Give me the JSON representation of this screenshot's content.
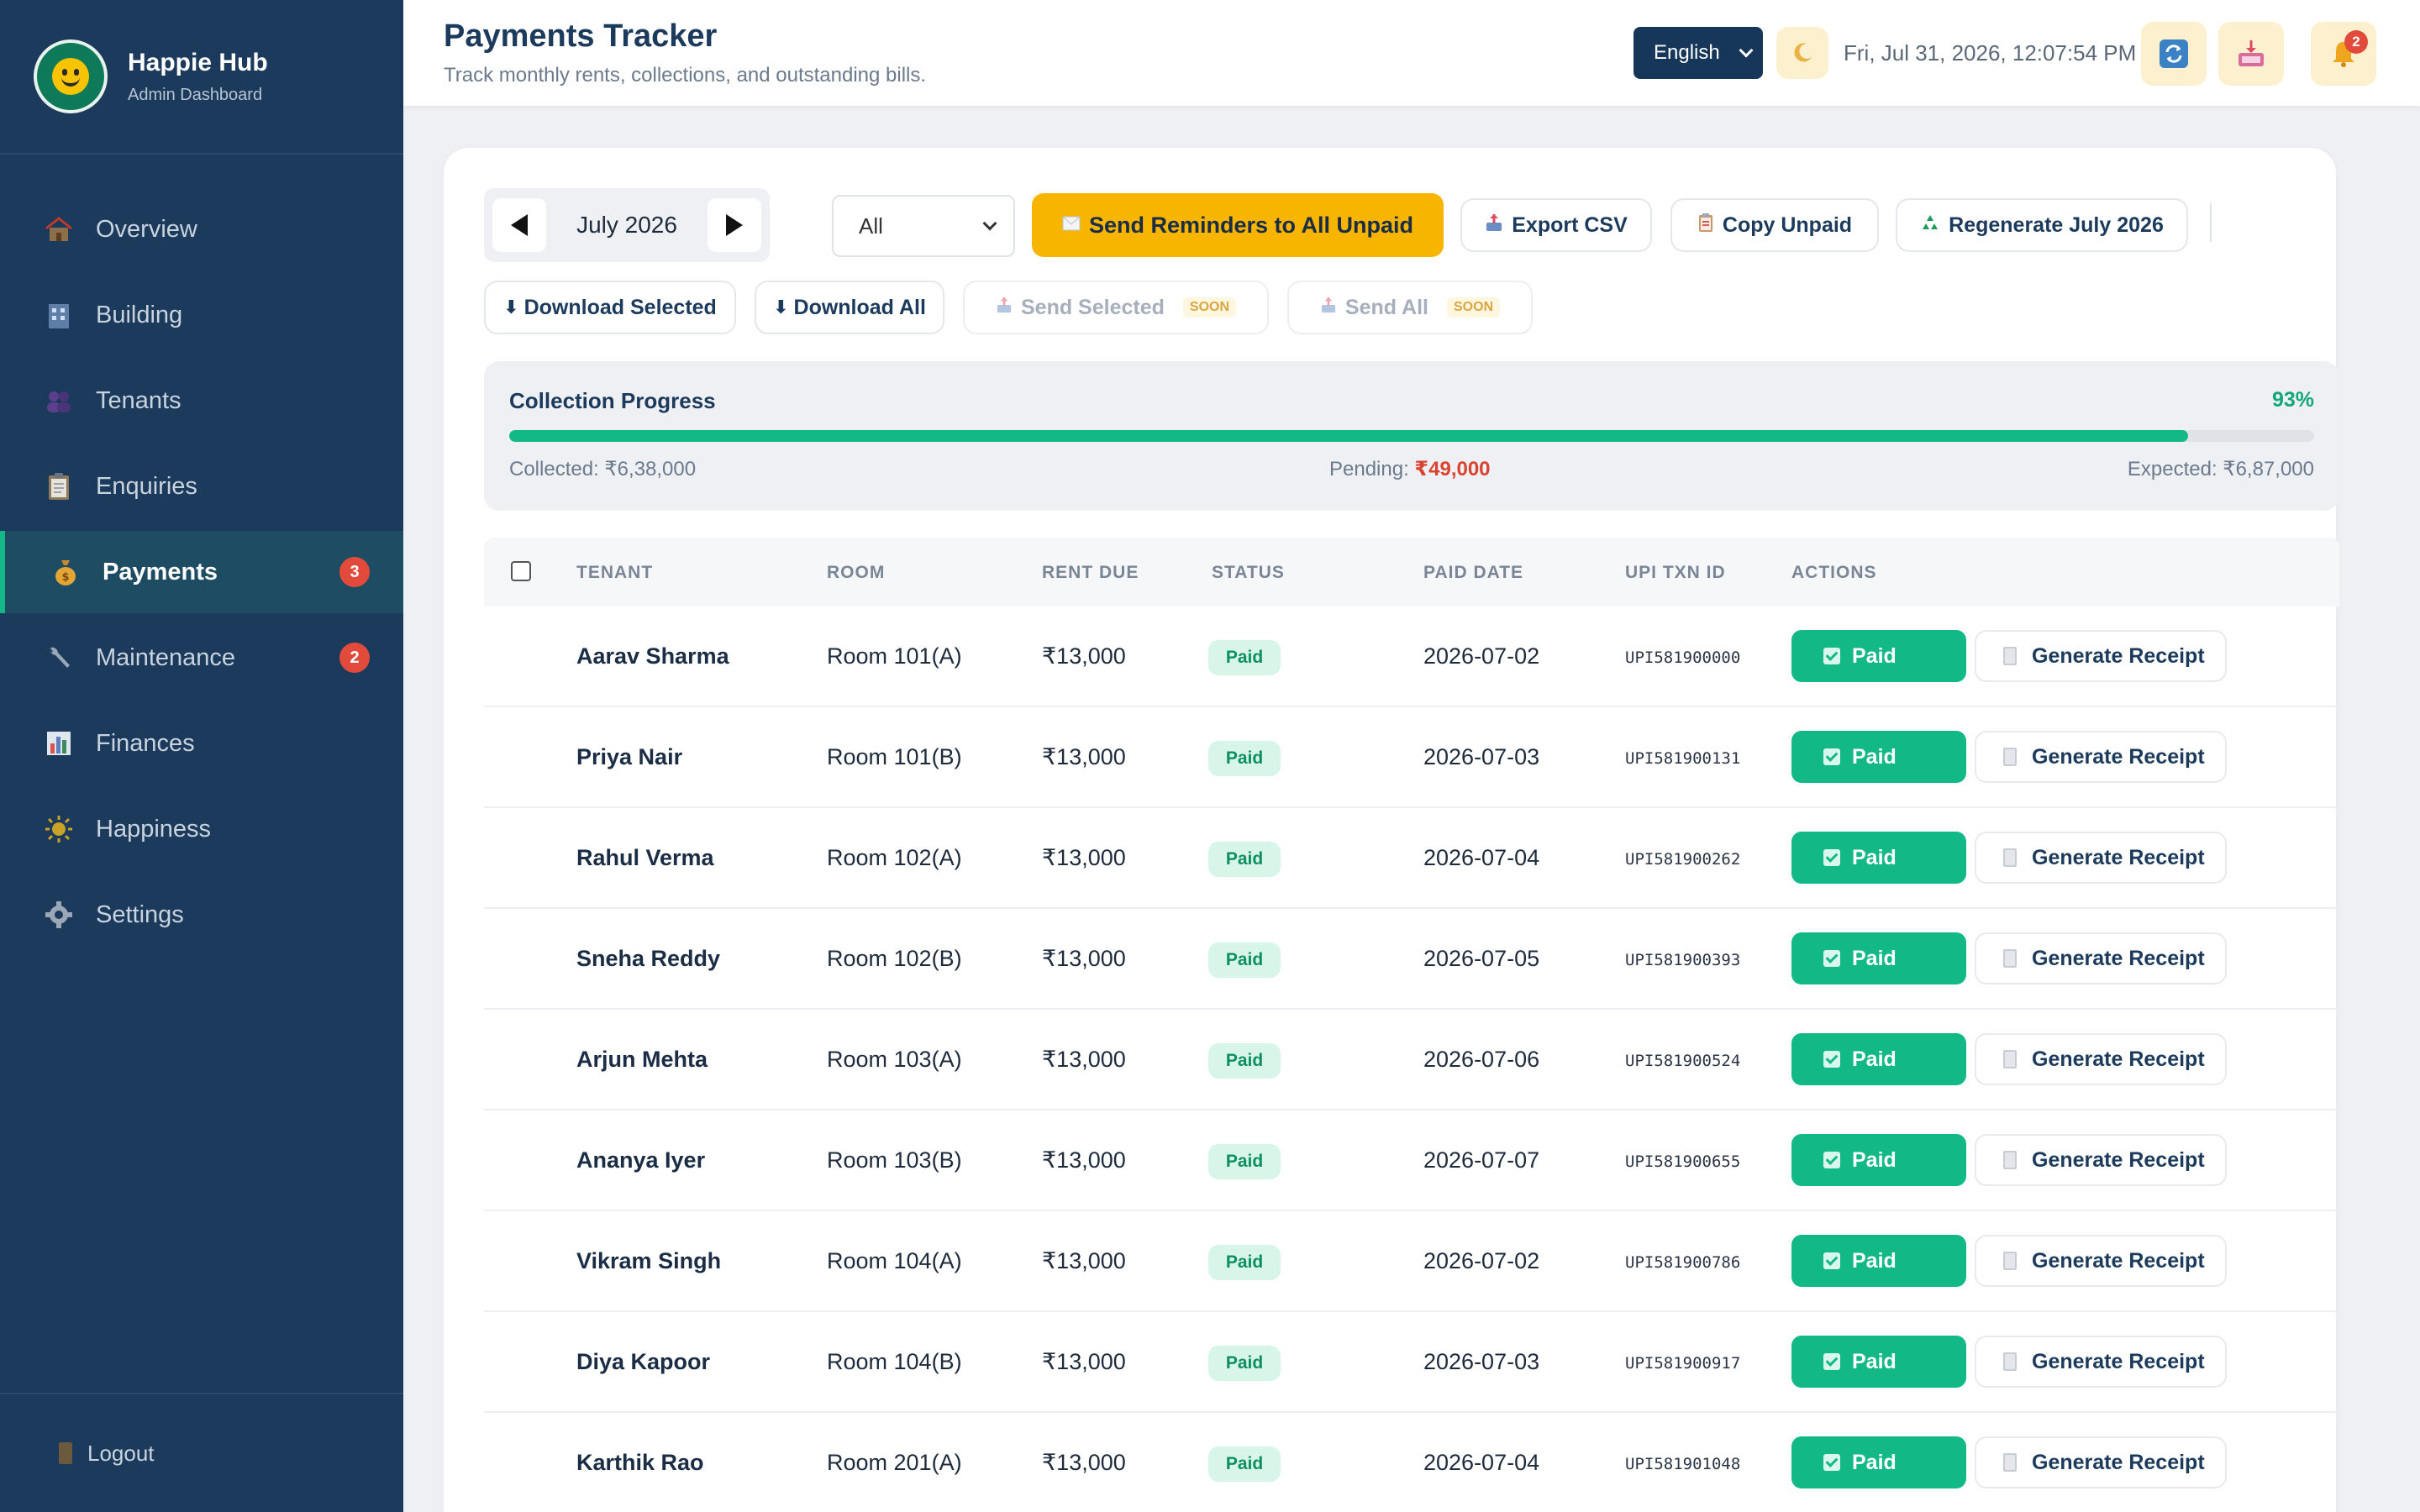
{
  "brand": {
    "title": "Happie Hub",
    "subtitle": "Admin Dashboard"
  },
  "sidebar": {
    "items": [
      {
        "label": "Overview",
        "icon": "house-icon"
      },
      {
        "label": "Building",
        "icon": "building-icon"
      },
      {
        "label": "Tenants",
        "icon": "people-icon"
      },
      {
        "label": "Enquiries",
        "icon": "clipboard-icon"
      },
      {
        "label": "Payments",
        "icon": "money-bag-icon",
        "active": true,
        "badge": "3"
      },
      {
        "label": "Maintenance",
        "icon": "wrench-icon",
        "badge": "2"
      },
      {
        "label": "Finances",
        "icon": "bar-chart-icon"
      },
      {
        "label": "Happiness",
        "icon": "sun-icon"
      },
      {
        "label": "Settings",
        "icon": "gear-icon"
      }
    ],
    "logout_label": "Logout"
  },
  "header": {
    "title": "Payments Tracker",
    "subtitle": "Track monthly rents, collections, and outstanding bills.",
    "language": "English",
    "datetime": "Fri, Jul 31, 2026, 12:07:54 PM",
    "notification_count": "2"
  },
  "toolbar": {
    "month": "July 2026",
    "filter_value": "All",
    "send_reminders": "Send Reminders to All Unpaid",
    "export_csv": "Export CSV",
    "copy_unpaid": "Copy Unpaid",
    "regenerate": "Regenerate July 2026",
    "download_selected": "Download Selected",
    "download_all": "Download All",
    "send_selected": "Send Selected",
    "send_all": "Send All",
    "soon": "SOON"
  },
  "progress": {
    "title": "Collection Progress",
    "percent": "93%",
    "fraction": 0.93,
    "collected_label": "Collected:",
    "collected": "₹6,38,000",
    "pending_label": "Pending:",
    "pending": "₹49,000",
    "expected_label": "Expected:",
    "expected": "₹6,87,000"
  },
  "table": {
    "columns": [
      "TENANT",
      "ROOM",
      "RENT DUE",
      "STATUS",
      "PAID DATE",
      "UPI TXN ID",
      "ACTIONS"
    ],
    "paid_button": "Paid",
    "receipt_button": "Generate Receipt",
    "rows": [
      {
        "tenant": "Aarav Sharma",
        "room": "Room 101(A)",
        "rent": "₹13,000",
        "status": "Paid",
        "date": "2026-07-02",
        "upi": "UPI581900000"
      },
      {
        "tenant": "Priya Nair",
        "room": "Room 101(B)",
        "rent": "₹13,000",
        "status": "Paid",
        "date": "2026-07-03",
        "upi": "UPI581900131"
      },
      {
        "tenant": "Rahul Verma",
        "room": "Room 102(A)",
        "rent": "₹13,000",
        "status": "Paid",
        "date": "2026-07-04",
        "upi": "UPI581900262"
      },
      {
        "tenant": "Sneha Reddy",
        "room": "Room 102(B)",
        "rent": "₹13,000",
        "status": "Paid",
        "date": "2026-07-05",
        "upi": "UPI581900393"
      },
      {
        "tenant": "Arjun Mehta",
        "room": "Room 103(A)",
        "rent": "₹13,000",
        "status": "Paid",
        "date": "2026-07-06",
        "upi": "UPI581900524"
      },
      {
        "tenant": "Ananya Iyer",
        "room": "Room 103(B)",
        "rent": "₹13,000",
        "status": "Paid",
        "date": "2026-07-07",
        "upi": "UPI581900655"
      },
      {
        "tenant": "Vikram Singh",
        "room": "Room 104(A)",
        "rent": "₹13,000",
        "status": "Paid",
        "date": "2026-07-02",
        "upi": "UPI581900786"
      },
      {
        "tenant": "Diya Kapoor",
        "room": "Room 104(B)",
        "rent": "₹13,000",
        "status": "Paid",
        "date": "2026-07-03",
        "upi": "UPI581900917"
      },
      {
        "tenant": "Karthik Rao",
        "room": "Room 201(A)",
        "rent": "₹13,000",
        "status": "Paid",
        "date": "2026-07-04",
        "upi": "UPI581901048"
      }
    ]
  },
  "colors": {
    "sidebar": "#1b3a5c",
    "accent_green": "#12b886",
    "primary_yellow": "#f7b500",
    "danger_red": "#e24b3b"
  }
}
